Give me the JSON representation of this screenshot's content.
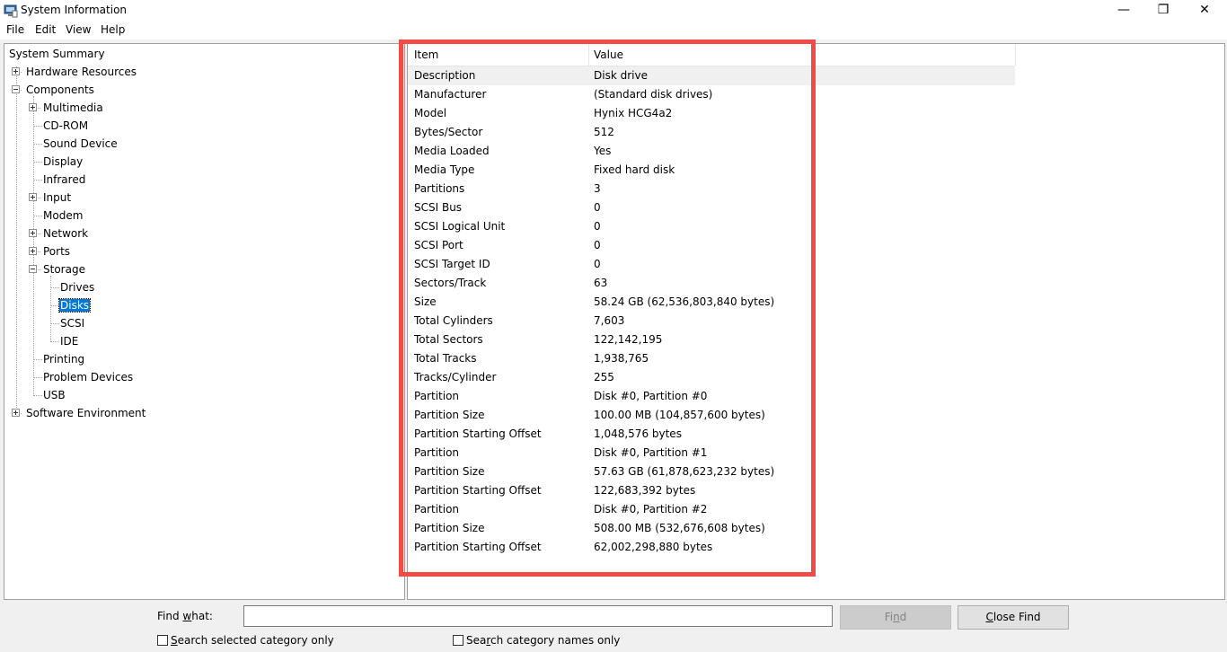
{
  "window": {
    "title": "System Information",
    "minimize_glyph": "—",
    "restore_glyph": "❐",
    "close_glyph": "✕"
  },
  "menu": [
    "File",
    "Edit",
    "View",
    "Help"
  ],
  "tree": {
    "system_summary": "System Summary",
    "hardware_resources": "Hardware Resources",
    "components": "Components",
    "multimedia": "Multimedia",
    "cdrom": "CD-ROM",
    "sound_device": "Sound Device",
    "display": "Display",
    "infrared": "Infrared",
    "input": "Input",
    "modem": "Modem",
    "network": "Network",
    "ports": "Ports",
    "storage": "Storage",
    "drives": "Drives",
    "disks": "Disks",
    "scsi": "SCSI",
    "ide": "IDE",
    "printing": "Printing",
    "problem_devices": "Problem Devices",
    "usb": "USB",
    "software_environment": "Software Environment"
  },
  "list": {
    "columns": [
      "Item",
      "Value"
    ],
    "rows": [
      {
        "item": "Description",
        "value": "Disk drive"
      },
      {
        "item": "Manufacturer",
        "value": "(Standard disk drives)"
      },
      {
        "item": "Model",
        "value": "Hynix HCG4a2"
      },
      {
        "item": "Bytes/Sector",
        "value": "512"
      },
      {
        "item": "Media Loaded",
        "value": "Yes"
      },
      {
        "item": "Media Type",
        "value": "Fixed hard disk"
      },
      {
        "item": "Partitions",
        "value": "3"
      },
      {
        "item": "SCSI Bus",
        "value": "0"
      },
      {
        "item": "SCSI Logical Unit",
        "value": "0"
      },
      {
        "item": "SCSI Port",
        "value": "0"
      },
      {
        "item": "SCSI Target ID",
        "value": "0"
      },
      {
        "item": "Sectors/Track",
        "value": "63"
      },
      {
        "item": "Size",
        "value": "58.24 GB (62,536,803,840 bytes)"
      },
      {
        "item": "Total Cylinders",
        "value": "7,603"
      },
      {
        "item": "Total Sectors",
        "value": "122,142,195"
      },
      {
        "item": "Total Tracks",
        "value": "1,938,765"
      },
      {
        "item": "Tracks/Cylinder",
        "value": "255"
      },
      {
        "item": "Partition",
        "value": "Disk #0, Partition #0"
      },
      {
        "item": "Partition Size",
        "value": "100.00 MB (104,857,600 bytes)"
      },
      {
        "item": "Partition Starting Offset",
        "value": "1,048,576 bytes"
      },
      {
        "item": "Partition",
        "value": "Disk #0, Partition #1"
      },
      {
        "item": "Partition Size",
        "value": "57.63 GB (61,878,623,232 bytes)"
      },
      {
        "item": "Partition Starting Offset",
        "value": "122,683,392 bytes"
      },
      {
        "item": "Partition",
        "value": "Disk #0, Partition #2"
      },
      {
        "item": "Partition Size",
        "value": "508.00 MB (532,676,608 bytes)"
      },
      {
        "item": "Partition Starting Offset",
        "value": "62,002,298,880 bytes"
      }
    ]
  },
  "find": {
    "label_pre": "Find ",
    "label_accel": "w",
    "label_post": "hat:",
    "input_value": "",
    "find_pre": "Fi",
    "find_accel": "n",
    "find_post": "d",
    "close_accel": "C",
    "close_post": "lose Find",
    "search_selected_accel": "S",
    "search_selected_post": "earch selected category only",
    "search_names_pre": "Sea",
    "search_names_accel": "r",
    "search_names_post": "ch category names only"
  },
  "colors": {
    "selection": "#0078d7",
    "highlight_box": "#f24a47"
  }
}
